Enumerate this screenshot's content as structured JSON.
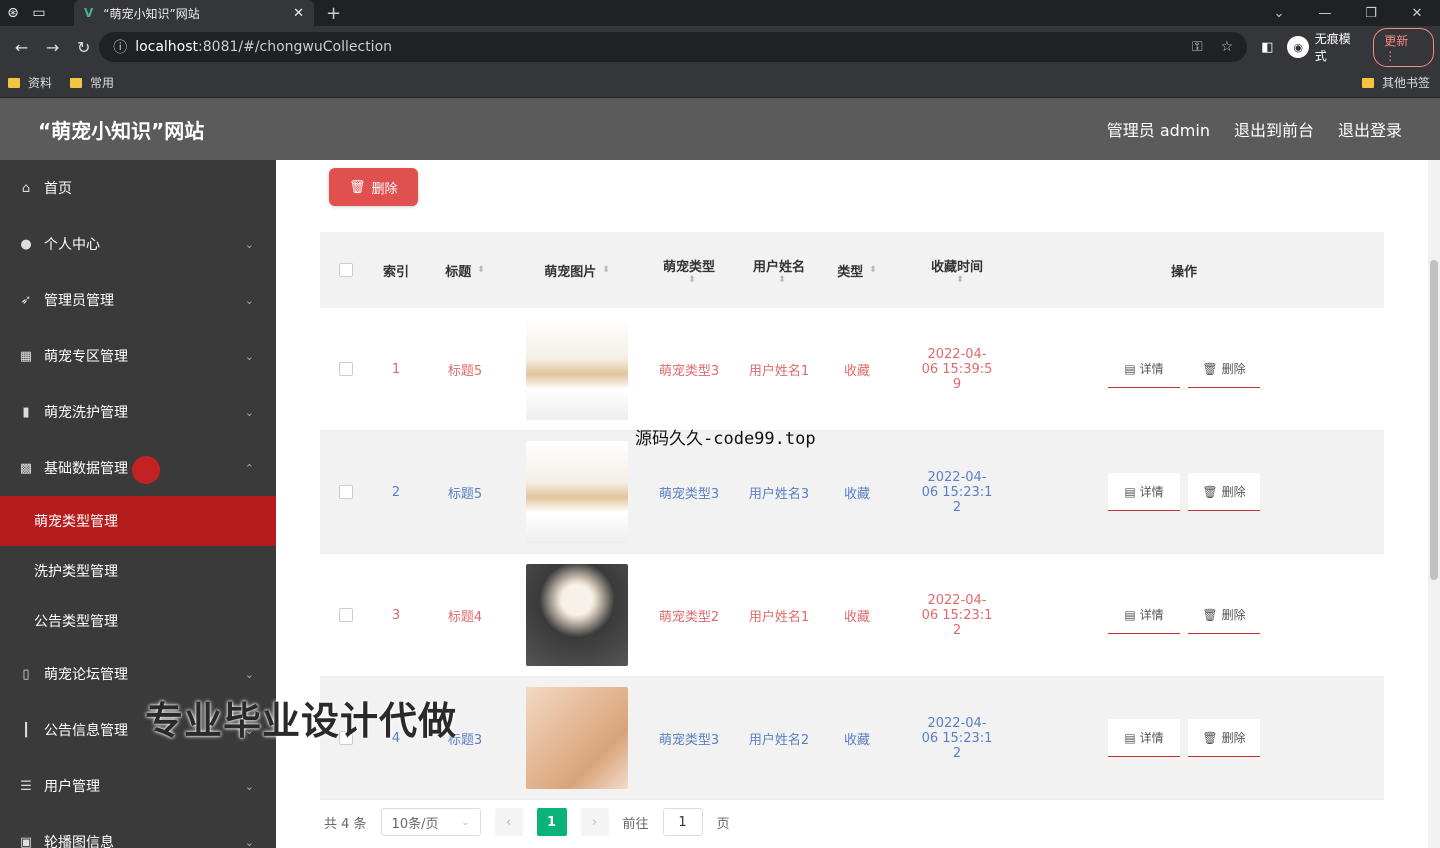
{
  "browser": {
    "tab_title": "“萌宠小知识”网站",
    "url_host": "localhost",
    "url_rest": ":8081/#/chongwuCollection",
    "incognito_label": "无痕模式",
    "update_label": "更新",
    "bookmarks": [
      "资料",
      "常用"
    ],
    "other_bookmarks": "其他书签"
  },
  "header": {
    "title": "“萌宠小知识”网站",
    "admin_label": "管理员 admin",
    "to_front": "退出到前台",
    "logout": "退出登录"
  },
  "sidebar": {
    "items": [
      {
        "label": "首页",
        "icon": "home-icon"
      },
      {
        "label": "个人中心",
        "icon": "user-icon"
      },
      {
        "label": "管理员管理",
        "icon": "send-icon"
      },
      {
        "label": "萌宠专区管理",
        "icon": "grid-icon"
      },
      {
        "label": "萌宠洗护管理",
        "icon": "chart-icon"
      },
      {
        "label": "基础数据管理",
        "icon": "data-icon"
      }
    ],
    "sub_items": [
      "萌宠类型管理",
      "洗护类型管理",
      "公告类型管理"
    ],
    "items_after": [
      {
        "label": "萌宠论坛管理",
        "icon": "phone-icon"
      },
      {
        "label": "公告信息管理",
        "icon": "bar-icon"
      },
      {
        "label": "用户管理",
        "icon": "list-icon"
      },
      {
        "label": "轮播图信息",
        "icon": "image-icon"
      }
    ]
  },
  "toolbar": {
    "delete_label": "删除"
  },
  "table": {
    "headers": {
      "index": "索引",
      "title": "标题",
      "image": "萌宠图片",
      "pet_type": "萌宠类型",
      "user_name": "用户姓名",
      "type": "类型",
      "time": "收藏时间",
      "ops": "操作"
    },
    "rows": [
      {
        "index": "1",
        "title": "标题5",
        "pet_type": "萌宠类型3",
        "user": "用户姓名1",
        "type": "收藏",
        "time1": "2022-04-",
        "time2": "06 15:39:5",
        "time3": "9"
      },
      {
        "index": "2",
        "title": "标题5",
        "pet_type": "萌宠类型3",
        "user": "用户姓名3",
        "type": "收藏",
        "time1": "2022-04-",
        "time2": "06 15:23:1",
        "time3": "2"
      },
      {
        "index": "3",
        "title": "标题4",
        "pet_type": "萌宠类型2",
        "user": "用户姓名1",
        "type": "收藏",
        "time1": "2022-04-",
        "time2": "06 15:23:1",
        "time3": "2"
      },
      {
        "index": "4",
        "title": "标题3",
        "pet_type": "萌宠类型3",
        "user": "用户姓名2",
        "type": "收藏",
        "time1": "2022-04-",
        "time2": "06 15:23:1",
        "time3": "2"
      }
    ],
    "detail_label": "详情",
    "delete_label": "删除"
  },
  "pager": {
    "total": "共 4 条",
    "size": "10条/页",
    "current": "1",
    "goto": "前往",
    "goto_value": "1",
    "page_unit": "页"
  },
  "overlay": {
    "source": "源码久久-code99.top",
    "banner": "专业毕业设计代做"
  }
}
